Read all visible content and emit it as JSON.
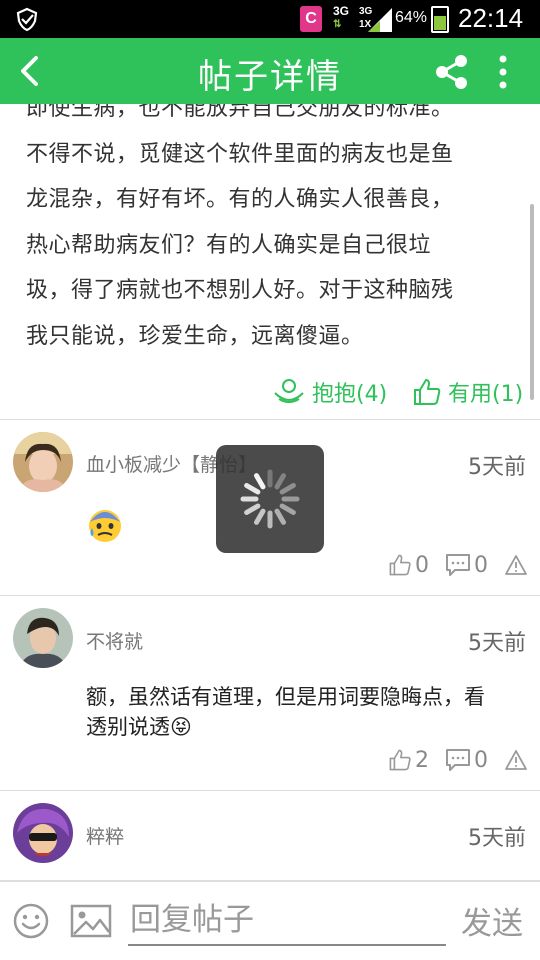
{
  "status_bar": {
    "app_badge": "C",
    "net1": "3G",
    "net2": "3G",
    "net2_sub": "1X",
    "battery_pct": "64%",
    "time": "22:14"
  },
  "header": {
    "title": "帖子详情",
    "back_icon": "chevron-left-icon",
    "share_icon": "share-icon",
    "more_icon": "more-vertical-icon",
    "bg_color": "#2fc15a"
  },
  "post": {
    "lines": [
      "即使生病，也不能放弃自己交朋友的标准。",
      "不得不说，觅健这个软件里面的病友也是鱼",
      "龙混杂，有好有坏。有的人确实人很善良，",
      "热心帮助病友们？有的人确实是自己很垃",
      "圾，得了病就也不想别人好。对于这种脑残",
      "我只能说，珍爱生命，远离傻逼。"
    ],
    "hug_label": "抱抱(4)",
    "useful_label": "有用(1)"
  },
  "comments": [
    {
      "name": "血小板减少【静怡】",
      "time": "5天前",
      "text": "",
      "emoji": "anxious-sweat-emoji",
      "likes": "0",
      "replies": "0"
    },
    {
      "name": "不将就",
      "time": "5天前",
      "text": "额，虽然话有道理，但是用词要隐晦点，看透别说透😝",
      "likes": "2",
      "replies": "0"
    },
    {
      "name": "粹粹",
      "time": "5天前"
    }
  ],
  "bottom": {
    "reply_placeholder": "回复帖子",
    "send_label": "发送"
  }
}
